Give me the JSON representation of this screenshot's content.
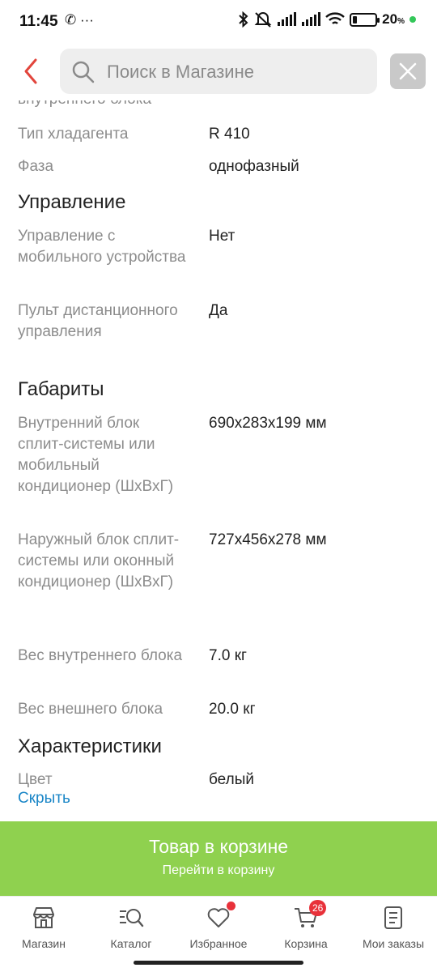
{
  "status_bar": {
    "time": "11:45",
    "left_icons": "✆ ···",
    "battery_percent": "20",
    "battery_unit": "%",
    "battery_level": 0.2
  },
  "search": {
    "placeholder": "Поиск в Магазине"
  },
  "specs": {
    "cut_label": "внутреннего блока",
    "rows_a": [
      {
        "label": "Тип хладагента",
        "value": "R 410"
      },
      {
        "label": "Фаза",
        "value": "однофазный"
      }
    ],
    "section_control": "Управление",
    "rows_b": [
      {
        "label": "Управление с мобильного устройства",
        "value": "Нет"
      },
      {
        "label": "Пульт дистанционного управления",
        "value": "Да"
      }
    ],
    "section_dimensions": "Габариты",
    "rows_c": [
      {
        "label": "Внутренний блок сплит-системы или мобильный кондиционер (ШхВхГ)",
        "value": "690x283x199 мм"
      },
      {
        "label": "Наружный блок сплит-системы или оконный кондиционер (ШхВхГ)",
        "value": "727x456x278 мм"
      },
      {
        "label": "Вес внутреннего блока",
        "value": "7.0 кг"
      },
      {
        "label": "Вес внешнего блока",
        "value": "20.0 кг"
      }
    ],
    "section_characteristics": "Характеристики",
    "rows_d": [
      {
        "label": "Цвет",
        "value": "белый"
      }
    ],
    "hide_link": "Скрыть"
  },
  "cart_banner": {
    "title": "Товар в корзине",
    "subtitle": "Перейти в корзину"
  },
  "bottom_nav": {
    "items": [
      {
        "label": "Магазин",
        "icon": "store-icon"
      },
      {
        "label": "Каталог",
        "icon": "catalog-search-icon"
      },
      {
        "label": "Избранное",
        "icon": "heart-icon"
      },
      {
        "label": "Корзина",
        "icon": "cart-icon"
      },
      {
        "label": "Мои заказы",
        "icon": "orders-icon"
      }
    ],
    "cart_count": "26"
  },
  "colors": {
    "accent_green": "#8fd14f",
    "link_blue": "#1a86c7",
    "badge_red": "#e8313a",
    "back_arrow_red": "#e2453c"
  }
}
